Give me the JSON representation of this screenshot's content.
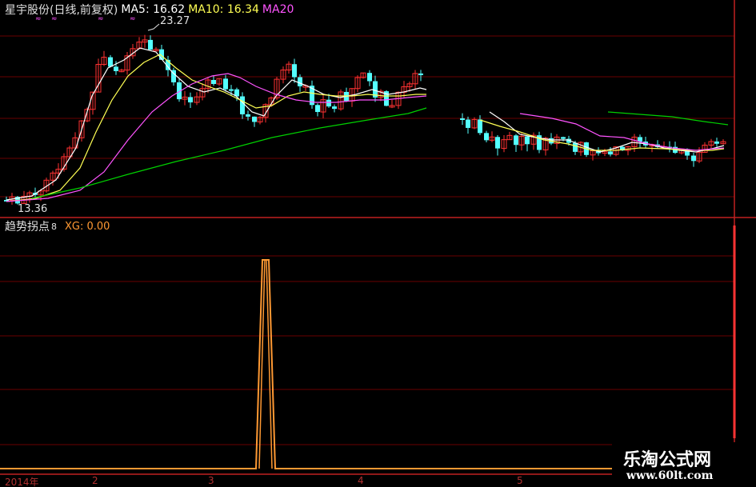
{
  "header": {
    "stock_name": "星宇股份(日线,前复权)",
    "ma5_label": "MA5: 16.62",
    "ma10_label": "MA10: 16.34",
    "ma20_label": "MA20"
  },
  "price_chart": {
    "high_label": "23.27",
    "low_label": "13.36"
  },
  "indicator": {
    "name": "趋势拐点",
    "param": "8",
    "xg_label": "XG: 0.00"
  },
  "date_axis": {
    "year_label": "2014年",
    "months": [
      "2",
      "3",
      "4",
      "5"
    ]
  },
  "watermark": {
    "brand": "乐淘公式网",
    "url": "www.60lt.com"
  },
  "colors": {
    "background": "#000000",
    "up_candle": "#ff3232",
    "down_candle": "#54ffff",
    "ma5": "#ffffff",
    "ma10": "#ffff54",
    "ma20": "#ff54ff",
    "ma60": "#00d000",
    "indicator_line": "#ff9933",
    "frame": "#c02020",
    "grid": "#6a0000"
  },
  "chart_data": {
    "type": "candlestick",
    "ylim": [
      13.36,
      23.27
    ],
    "series": [
      {
        "name": "MA5",
        "values": []
      },
      {
        "name": "MA10",
        "values": []
      },
      {
        "name": "MA20",
        "values": []
      }
    ],
    "annotations": [
      "23.27",
      "13.36"
    ],
    "indicator": {
      "name": "XG",
      "type": "line",
      "peak_value": 1,
      "baseline_value": 0
    }
  }
}
